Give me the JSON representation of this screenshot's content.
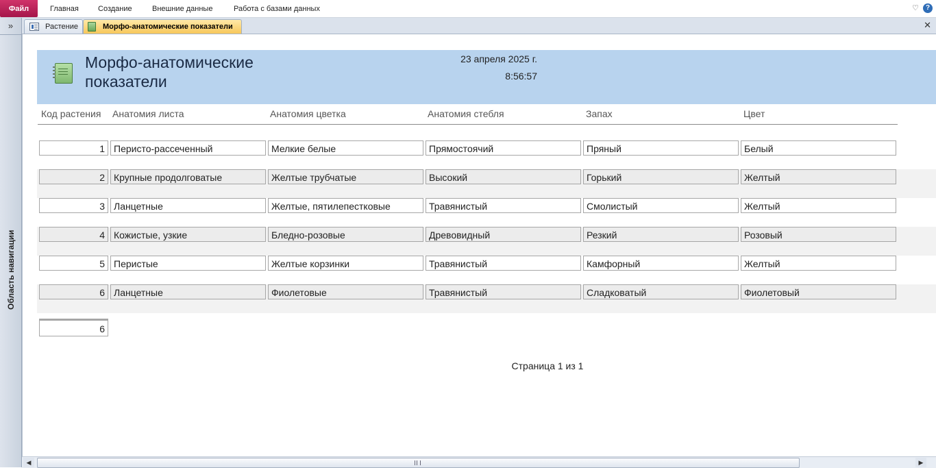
{
  "menu": {
    "file": "Файл",
    "items": [
      "Главная",
      "Создание",
      "Внешние данные",
      "Работа с базами данных"
    ]
  },
  "nav": {
    "toggle": "»",
    "label": "Область навигации"
  },
  "tabs": [
    {
      "label": "Растение",
      "icon": "form-icon",
      "active": false
    },
    {
      "label": "Морфо-анатомические показатели",
      "icon": "report-icon",
      "active": true
    }
  ],
  "report": {
    "title": "Морфо-анатомические показатели",
    "date": "23 апреля 2025 г.",
    "time": "8:56:57",
    "columns": [
      "Код растения",
      "Анатомия листа",
      "Анатомия цветка",
      "Анатомия стебля",
      "Запах",
      "Цвет"
    ],
    "rows": [
      [
        "1",
        "Перисто-рассеченный",
        "Мелкие белые",
        "Прямостоячий",
        "Пряный",
        "Белый"
      ],
      [
        "2",
        "Крупные продолговатые",
        "Желтые трубчатые",
        "Высокий",
        "Горький",
        "Желтый"
      ],
      [
        "3",
        "Ланцетные",
        "Желтые, пятилепестковые",
        "Травянистый",
        "Смолистый",
        "Желтый"
      ],
      [
        "4",
        "Кожистые, узкие",
        "Бледно-розовые",
        "Древовидный",
        "Резкий",
        "Розовый"
      ],
      [
        "5",
        "Перистые",
        "Желтые корзинки",
        "Травянистый",
        "Камфорный",
        "Желтый"
      ],
      [
        "6",
        "Ланцетные",
        "Фиолетовые",
        "Травянистый",
        "Сладковатый",
        "Фиолетовый"
      ]
    ],
    "total": "6",
    "footer": "Страница 1 из 1"
  },
  "colors": {
    "accent_file": "#c0245a",
    "header_band": "#b8d3ee",
    "active_tab": "#f7c75b"
  }
}
